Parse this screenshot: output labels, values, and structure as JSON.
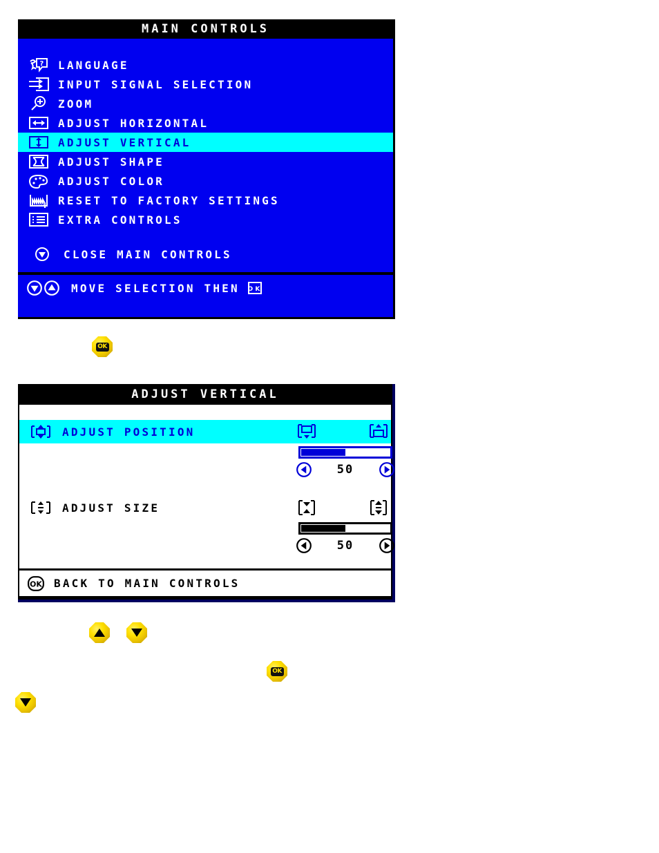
{
  "main_panel": {
    "title": "MAIN CONTROLS",
    "items": [
      {
        "icon": "language-icon",
        "label": "LANGUAGE",
        "selected": false
      },
      {
        "icon": "input-signal-icon",
        "label": "INPUT SIGNAL SELECTION",
        "selected": false
      },
      {
        "icon": "zoom-icon",
        "label": "ZOOM",
        "selected": false
      },
      {
        "icon": "adjust-horizontal-icon",
        "label": "ADJUST HORIZONTAL",
        "selected": false
      },
      {
        "icon": "adjust-vertical-icon",
        "label": "ADJUST VERTICAL",
        "selected": true
      },
      {
        "icon": "adjust-shape-icon",
        "label": "ADJUST SHAPE",
        "selected": false
      },
      {
        "icon": "adjust-color-icon",
        "label": "ADJUST COLOR",
        "selected": false
      },
      {
        "icon": "reset-factory-icon",
        "label": "RESET TO FACTORY SETTINGS",
        "selected": false
      },
      {
        "icon": "extra-controls-icon",
        "label": "EXTRA CONTROLS",
        "selected": false
      }
    ],
    "close_item": {
      "icon": "down-arrow-circle-icon",
      "label": "CLOSE MAIN CONTROLS"
    },
    "status_bar": {
      "icons": [
        "down-arrow-circle-icon",
        "up-arrow-circle-icon"
      ],
      "text": "MOVE SELECTION THEN",
      "trailing_icon": "ok-key-icon"
    }
  },
  "sub_panel": {
    "title": "ADJUST VERTICAL",
    "rows": [
      {
        "icon": "position-vertical-icon",
        "label": "ADJUST POSITION",
        "selected": true,
        "left_action_icon": "move-down-icon",
        "right_action_icon": "move-up-icon",
        "value": "50",
        "fill_percent": 50,
        "dec_icon": "left-arrow-circle-icon",
        "inc_icon": "right-arrow-circle-icon"
      },
      {
        "icon": "size-vertical-icon",
        "label": "ADJUST SIZE",
        "selected": false,
        "left_action_icon": "shrink-vertical-icon",
        "right_action_icon": "expand-vertical-icon",
        "value": "50",
        "fill_percent": 50,
        "dec_icon": "left-arrow-circle-icon",
        "inc_icon": "right-arrow-circle-icon"
      }
    ],
    "footer": {
      "icon": "ok-key-icon",
      "label": "BACK TO MAIN CONTROLS"
    }
  },
  "buttons": [
    {
      "name": "ok-button-top",
      "glyph": "ok"
    },
    {
      "name": "up-button",
      "glyph": "up"
    },
    {
      "name": "down-button",
      "glyph": "down"
    },
    {
      "name": "ok-button-bottom",
      "glyph": "ok"
    },
    {
      "name": "down-button-last",
      "glyph": "down"
    }
  ],
  "colors": {
    "osd_blue": "#0000f0",
    "highlight_cyan": "#00ffff",
    "ink_blue": "#0000d8",
    "black": "#000000",
    "white": "#ffffff",
    "button_yellow": "#ffe000"
  }
}
